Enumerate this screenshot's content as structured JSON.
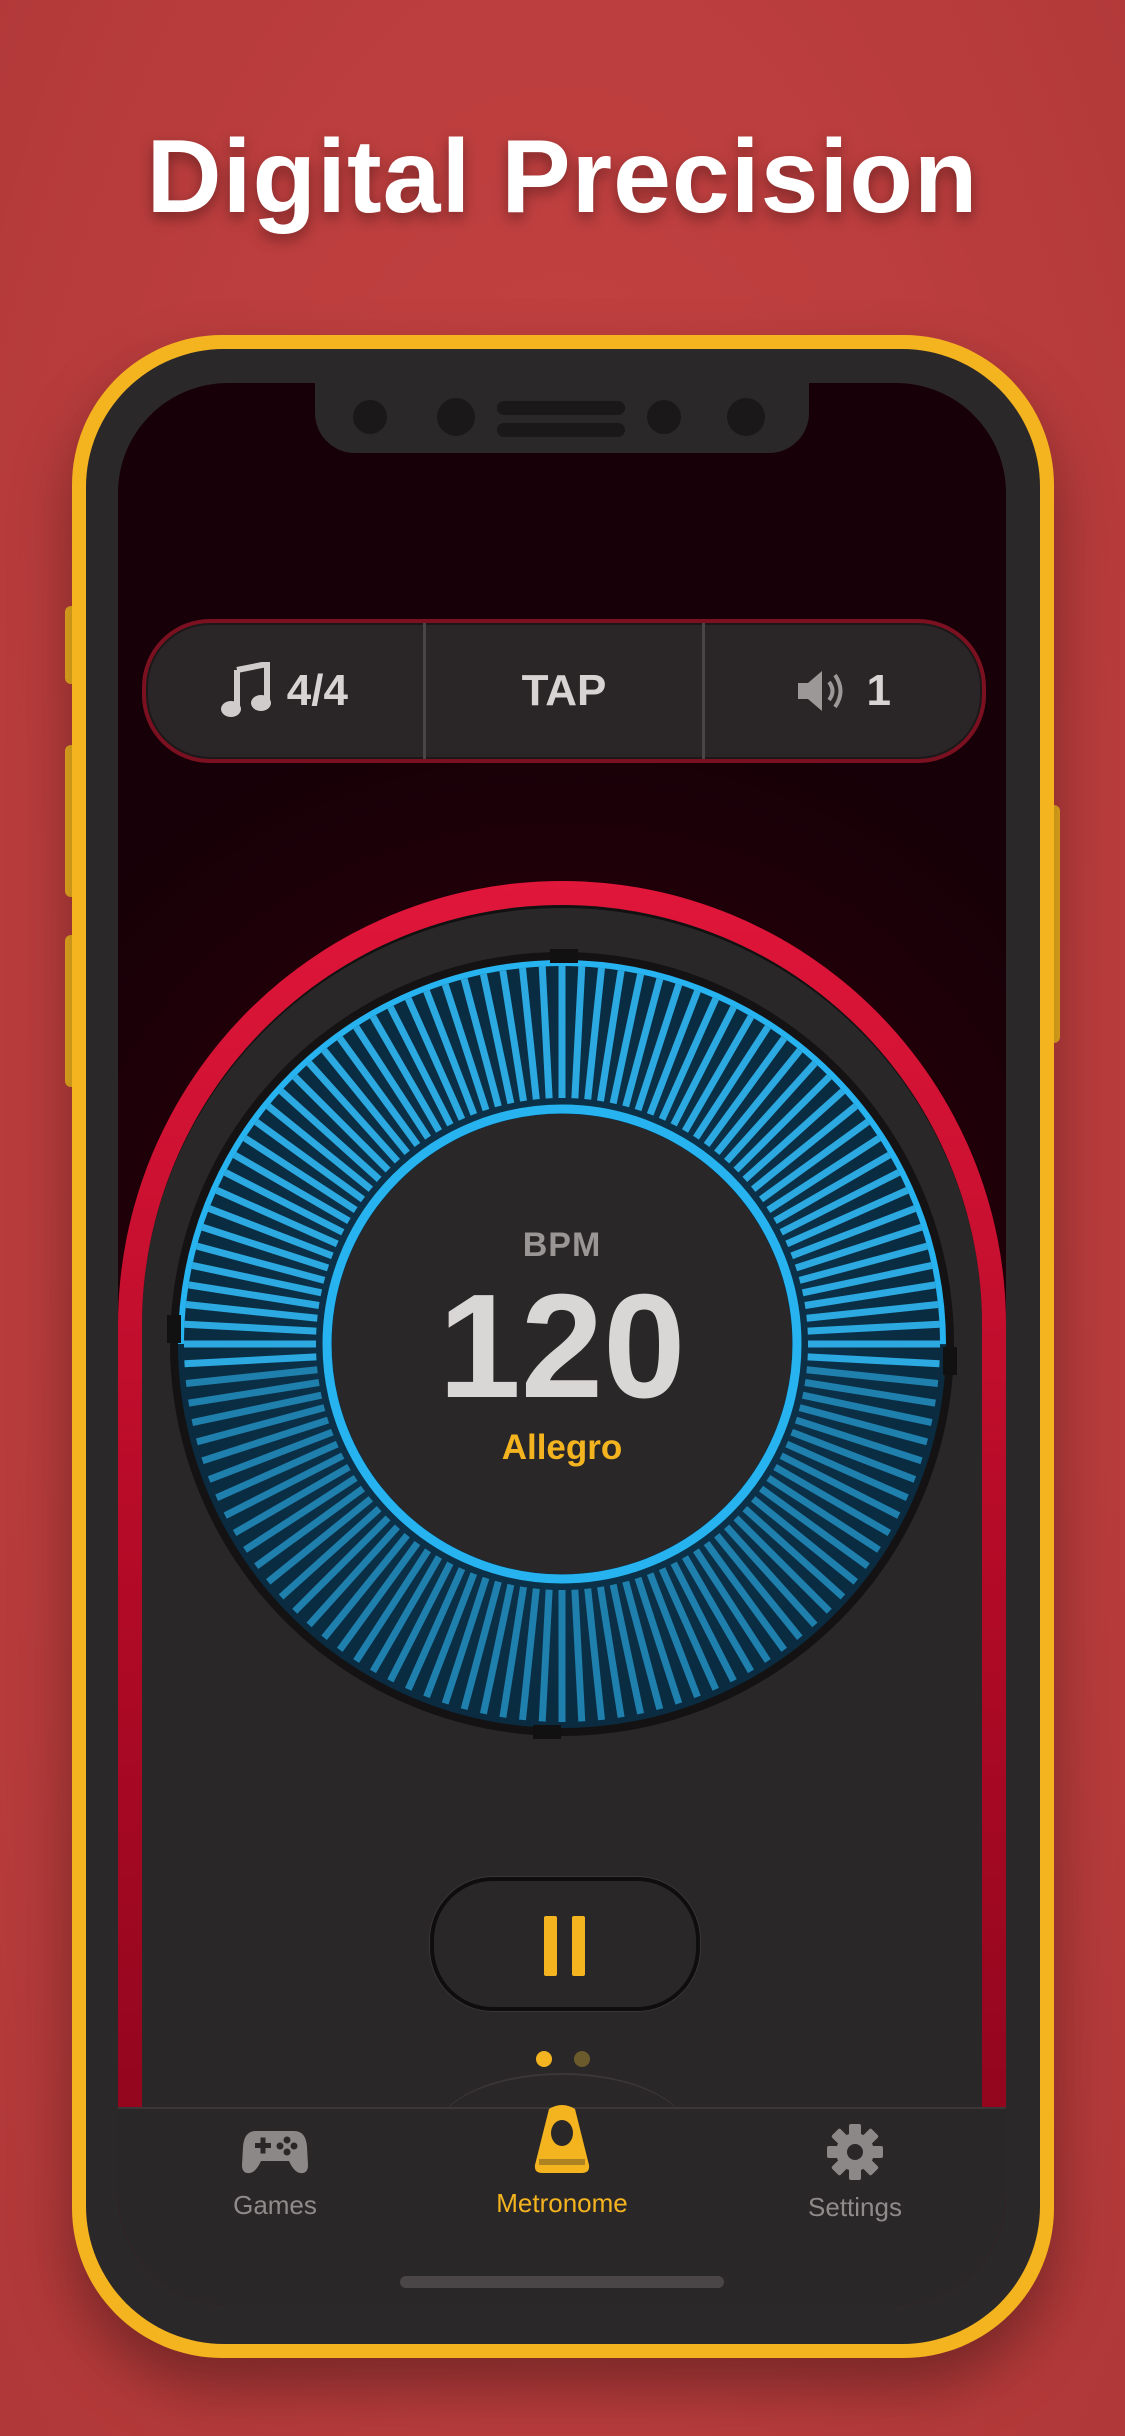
{
  "headline": "Digital Precision",
  "controls": {
    "time_signature": "4/4",
    "tap_label": "TAP",
    "volume_value": "1"
  },
  "metronome": {
    "bpm_label": "BPM",
    "bpm_value": "120",
    "tempo_name": "Allegro"
  },
  "pager": {
    "pages": 2,
    "current": 1
  },
  "tabs": [
    {
      "label": "Games",
      "icon": "gamepad-icon",
      "active": false
    },
    {
      "label": "Metronome",
      "icon": "metronome-icon",
      "active": true
    },
    {
      "label": "Settings",
      "icon": "gear-icon",
      "active": false
    }
  ],
  "colors": {
    "accent": "#f4b41f",
    "dial_blue": "#29b6f0",
    "arch_red": "#d8143a",
    "background": "#bd3e3e"
  }
}
